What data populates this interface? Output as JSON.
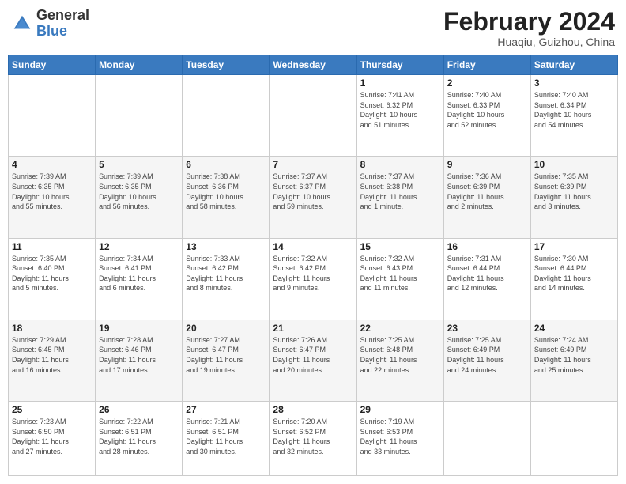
{
  "header": {
    "logo_general": "General",
    "logo_blue": "Blue",
    "month_title": "February 2024",
    "location": "Huaqiu, Guizhou, China"
  },
  "days_of_week": [
    "Sunday",
    "Monday",
    "Tuesday",
    "Wednesday",
    "Thursday",
    "Friday",
    "Saturday"
  ],
  "weeks": [
    [
      {
        "day": "",
        "info": ""
      },
      {
        "day": "",
        "info": ""
      },
      {
        "day": "",
        "info": ""
      },
      {
        "day": "",
        "info": ""
      },
      {
        "day": "1",
        "info": "Sunrise: 7:41 AM\nSunset: 6:32 PM\nDaylight: 10 hours\nand 51 minutes."
      },
      {
        "day": "2",
        "info": "Sunrise: 7:40 AM\nSunset: 6:33 PM\nDaylight: 10 hours\nand 52 minutes."
      },
      {
        "day": "3",
        "info": "Sunrise: 7:40 AM\nSunset: 6:34 PM\nDaylight: 10 hours\nand 54 minutes."
      }
    ],
    [
      {
        "day": "4",
        "info": "Sunrise: 7:39 AM\nSunset: 6:35 PM\nDaylight: 10 hours\nand 55 minutes."
      },
      {
        "day": "5",
        "info": "Sunrise: 7:39 AM\nSunset: 6:35 PM\nDaylight: 10 hours\nand 56 minutes."
      },
      {
        "day": "6",
        "info": "Sunrise: 7:38 AM\nSunset: 6:36 PM\nDaylight: 10 hours\nand 58 minutes."
      },
      {
        "day": "7",
        "info": "Sunrise: 7:37 AM\nSunset: 6:37 PM\nDaylight: 10 hours\nand 59 minutes."
      },
      {
        "day": "8",
        "info": "Sunrise: 7:37 AM\nSunset: 6:38 PM\nDaylight: 11 hours\nand 1 minute."
      },
      {
        "day": "9",
        "info": "Sunrise: 7:36 AM\nSunset: 6:39 PM\nDaylight: 11 hours\nand 2 minutes."
      },
      {
        "day": "10",
        "info": "Sunrise: 7:35 AM\nSunset: 6:39 PM\nDaylight: 11 hours\nand 3 minutes."
      }
    ],
    [
      {
        "day": "11",
        "info": "Sunrise: 7:35 AM\nSunset: 6:40 PM\nDaylight: 11 hours\nand 5 minutes."
      },
      {
        "day": "12",
        "info": "Sunrise: 7:34 AM\nSunset: 6:41 PM\nDaylight: 11 hours\nand 6 minutes."
      },
      {
        "day": "13",
        "info": "Sunrise: 7:33 AM\nSunset: 6:42 PM\nDaylight: 11 hours\nand 8 minutes."
      },
      {
        "day": "14",
        "info": "Sunrise: 7:32 AM\nSunset: 6:42 PM\nDaylight: 11 hours\nand 9 minutes."
      },
      {
        "day": "15",
        "info": "Sunrise: 7:32 AM\nSunset: 6:43 PM\nDaylight: 11 hours\nand 11 minutes."
      },
      {
        "day": "16",
        "info": "Sunrise: 7:31 AM\nSunset: 6:44 PM\nDaylight: 11 hours\nand 12 minutes."
      },
      {
        "day": "17",
        "info": "Sunrise: 7:30 AM\nSunset: 6:44 PM\nDaylight: 11 hours\nand 14 minutes."
      }
    ],
    [
      {
        "day": "18",
        "info": "Sunrise: 7:29 AM\nSunset: 6:45 PM\nDaylight: 11 hours\nand 16 minutes."
      },
      {
        "day": "19",
        "info": "Sunrise: 7:28 AM\nSunset: 6:46 PM\nDaylight: 11 hours\nand 17 minutes."
      },
      {
        "day": "20",
        "info": "Sunrise: 7:27 AM\nSunset: 6:47 PM\nDaylight: 11 hours\nand 19 minutes."
      },
      {
        "day": "21",
        "info": "Sunrise: 7:26 AM\nSunset: 6:47 PM\nDaylight: 11 hours\nand 20 minutes."
      },
      {
        "day": "22",
        "info": "Sunrise: 7:25 AM\nSunset: 6:48 PM\nDaylight: 11 hours\nand 22 minutes."
      },
      {
        "day": "23",
        "info": "Sunrise: 7:25 AM\nSunset: 6:49 PM\nDaylight: 11 hours\nand 24 minutes."
      },
      {
        "day": "24",
        "info": "Sunrise: 7:24 AM\nSunset: 6:49 PM\nDaylight: 11 hours\nand 25 minutes."
      }
    ],
    [
      {
        "day": "25",
        "info": "Sunrise: 7:23 AM\nSunset: 6:50 PM\nDaylight: 11 hours\nand 27 minutes."
      },
      {
        "day": "26",
        "info": "Sunrise: 7:22 AM\nSunset: 6:51 PM\nDaylight: 11 hours\nand 28 minutes."
      },
      {
        "day": "27",
        "info": "Sunrise: 7:21 AM\nSunset: 6:51 PM\nDaylight: 11 hours\nand 30 minutes."
      },
      {
        "day": "28",
        "info": "Sunrise: 7:20 AM\nSunset: 6:52 PM\nDaylight: 11 hours\nand 32 minutes."
      },
      {
        "day": "29",
        "info": "Sunrise: 7:19 AM\nSunset: 6:53 PM\nDaylight: 11 hours\nand 33 minutes."
      },
      {
        "day": "",
        "info": ""
      },
      {
        "day": "",
        "info": ""
      }
    ]
  ]
}
